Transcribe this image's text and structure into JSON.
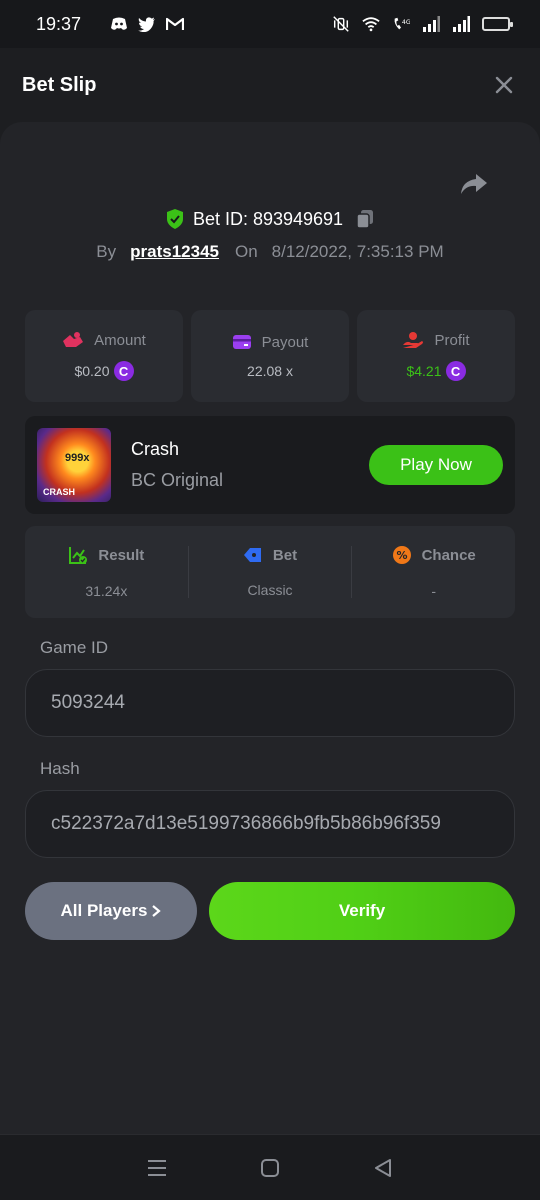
{
  "status_bar": {
    "time": "19:37",
    "left_icons": [
      "discord-icon",
      "twitter-icon",
      "gmail-icon"
    ],
    "right_icons": [
      "mute-vibrate-icon",
      "wifi-icon",
      "volte-icon",
      "signal-icon",
      "signal-icon",
      "battery-icon"
    ]
  },
  "header": {
    "title": "Bet Slip"
  },
  "bet": {
    "id_label": "Bet ID: 893949691",
    "by_label": "By",
    "user": "prats12345",
    "on_label": "On",
    "datetime": "8/12/2022, 7:35:13 PM"
  },
  "stats": {
    "amount_label": "Amount",
    "amount_value": "$0.20",
    "payout_label": "Payout",
    "payout_value": "22.08 x",
    "profit_label": "Profit",
    "profit_value": "$4.21",
    "coin_symbol": "C"
  },
  "game": {
    "thumb_multiplier": "999x",
    "thumb_label": "CRASH",
    "name": "Crash",
    "subtitle": "BC Original",
    "play_label": "Play Now"
  },
  "result": {
    "result_label": "Result",
    "result_value": "31.24x",
    "bet_label": "Bet",
    "bet_value": "Classic",
    "chance_label": "Chance",
    "chance_value": "-"
  },
  "fields": {
    "game_id_label": "Game ID",
    "game_id_value": "5093244",
    "hash_label": "Hash",
    "hash_value": "c522372a7d13e5199736866b9fb5b86b96f359"
  },
  "buttons": {
    "all_players": "All Players",
    "verify": "Verify"
  },
  "colors": {
    "accent_green": "#3bc117",
    "coin_purple": "#8a2be2",
    "background": "#17181b"
  }
}
